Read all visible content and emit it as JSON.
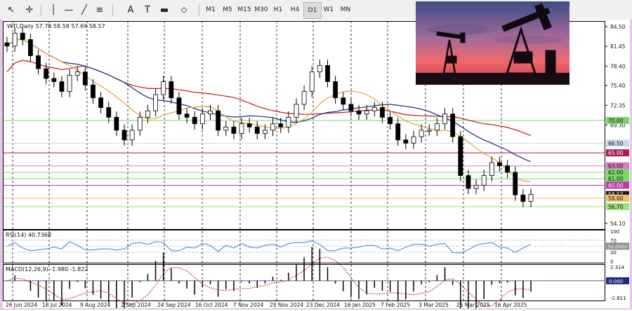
{
  "toolbar": {
    "tools": [
      {
        "name": "cursor-tool",
        "glyph": "↖"
      },
      {
        "name": "crosshair-tool",
        "glyph": "✛"
      },
      {
        "name": "vertical-line-tool",
        "glyph": "│"
      },
      {
        "name": "horizontal-line-tool",
        "glyph": "—"
      },
      {
        "name": "trendline-tool",
        "glyph": "╱"
      },
      {
        "name": "fibonacci-tool",
        "glyph": "≡"
      },
      {
        "name": "text-tool",
        "glyph": "A"
      },
      {
        "name": "text-label-tool",
        "glyph": "T"
      },
      {
        "name": "rectangle-tool",
        "glyph": "▬"
      },
      {
        "name": "shapes-tool",
        "glyph": "⬦"
      }
    ],
    "timeframes": [
      "M1",
      "M5",
      "M15",
      "M30",
      "H1",
      "H4",
      "D1",
      "W1",
      "MN"
    ],
    "active_timeframe": "D1"
  },
  "chart": {
    "symbol_line": "WTI,Daily  57.78 58.58 57.69 58.57",
    "rsi_label": "RSI(14) 40.7368",
    "macd_label": "MACD(12,26,9) -1.980 -1.822",
    "price_axis": [
      "84.50",
      "81.45",
      "78.40",
      "75.40",
      "72.35",
      "69.30",
      "66.30",
      "63.00",
      "57.20",
      "54.10"
    ],
    "level_tags": [
      {
        "text": "70.00",
        "color": "#7cd66a"
      },
      {
        "text": "66.50",
        "color": "#c9d8ee"
      },
      {
        "text": "65.00",
        "color": "#a01d5a"
      },
      {
        "text": "63.00",
        "color": "#d979c4"
      },
      {
        "text": "62.00",
        "color": "#7cd66a"
      },
      {
        "text": "61.00",
        "color": "#7cd66a"
      },
      {
        "text": "60.00",
        "color": "#b93aa4"
      },
      {
        "text": "58.57",
        "color": "#1a1a1a"
      },
      {
        "text": "58.00",
        "color": "#f2c06a"
      },
      {
        "text": "56.70",
        "color": "#9be37a"
      }
    ],
    "rsi_axis": [
      "100",
      "70",
      "50.0000",
      "30",
      "0"
    ],
    "macd_axis": [
      "2.314",
      "0.000",
      "-2.811"
    ],
    "dates": [
      "26 Jun 2024",
      "18 Jul 2024",
      "9 Aug 2024",
      "2 Sep 2024",
      "24 Sep 2024",
      "16 Oct 2024",
      "7 Nov 2024",
      "29 Nov 2024",
      "23 Dec 2024",
      "16 Jan 2025",
      "7 Feb 2025",
      "3 Mar 2025",
      "25 Mar 2025",
      "16 Apr 2025"
    ],
    "colors": {
      "ma_fast": "#e1a13a",
      "ma_mid": "#1d2a7a",
      "ma_slow": "#b81c1c",
      "rsi_line": "#3d7fd9",
      "macd_signal": "#b81c1c",
      "candle": "#000000"
    }
  },
  "chart_data": {
    "type": "candlestick",
    "title": "WTI,Daily",
    "ohlc_latest": {
      "open": 57.78,
      "high": 58.58,
      "low": 57.69,
      "close": 58.57
    },
    "x_range": [
      "26 Jun 2024",
      "16 Apr 2025"
    ],
    "ylim": [
      54.1,
      84.5
    ],
    "horizontal_levels": [
      70.0,
      66.5,
      65.0,
      63.0,
      62.0,
      61.0,
      60.0,
      58.0,
      56.7
    ],
    "approx_closes": [
      81.5,
      83.5,
      82.5,
      80.0,
      78.0,
      76.5,
      76.0,
      74.5,
      77.0,
      77.5,
      75.5,
      73.5,
      72.0,
      70.5,
      68.5,
      67.0,
      68.5,
      70.5,
      71.5,
      74.0,
      76.0,
      73.5,
      71.0,
      70.5,
      69.5,
      71.0,
      71.5,
      68.5,
      69.0,
      68.0,
      69.5,
      69.0,
      68.0,
      68.5,
      69.5,
      69.0,
      70.5,
      72.5,
      74.5,
      77.5,
      78.5,
      76.0,
      73.5,
      72.5,
      71.5,
      71.0,
      71.5,
      72.0,
      70.5,
      69.5,
      67.0,
      66.5,
      67.5,
      68.5,
      68.5,
      69.5,
      71.0,
      67.5,
      61.5,
      59.5,
      60.0,
      61.5,
      63.5,
      63.0,
      62.0,
      58.5,
      57.5,
      58.57
    ],
    "rsi": {
      "value": 40.7368,
      "levels": [
        70,
        50,
        30
      ]
    },
    "macd": {
      "main": -1.98,
      "signal": -1.822
    }
  }
}
